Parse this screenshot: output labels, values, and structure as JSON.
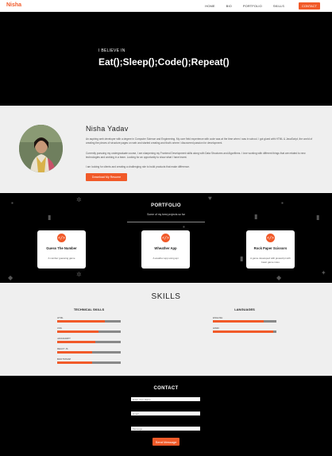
{
  "nav": {
    "brand": "Nisha",
    "links": [
      "HOME",
      "BIO",
      "PORTFOLIO",
      "SKILLS"
    ],
    "contact_label": "CONTACT"
  },
  "hero": {
    "pre": "I BELIEVE IN",
    "title": "Eat();Sleep();Code();Repeat()"
  },
  "about": {
    "name": "Nisha Yadav",
    "p1": "An aspiring web developer with a degree in Computer Science and Engineering. My core field experience with code was at the time when I was in school. I got glued with HTML & JavaScript, the world of creating the pieces of structure pages on web and started creating and that's where I discovered passion for development.",
    "p2": "Currently pursuing my undergraduate course, I am sharpening my Frontend Development skills along with Data Structures and Algorithms. I love working with different things that are related to new technologies and working in a team. Looking for an opportunity to show what I have learnt.",
    "p3": "I am looking for clients and creating a challenging role to build products that make difference.",
    "resume_label": "Download My Resume"
  },
  "portfolio": {
    "title": "PORTFOLIO",
    "subtitle": "Some of my best projects so far",
    "cards": [
      {
        "title": "Guess The Number",
        "desc": "A number guessing game",
        "icon": "code-icon"
      },
      {
        "title": "Wheather App",
        "desc": "A weather app using api",
        "icon": "code-icon"
      },
      {
        "title": "Rock Paper Scissors",
        "desc": "A game developed with javascript with basic game rules",
        "icon": "code-icon"
      }
    ]
  },
  "skills": {
    "title": "SKILLS",
    "technical_title": "TECHNICAL SKILLS",
    "languages_title": "LANGUAGES",
    "technical": [
      {
        "name": "HTML",
        "level": 0.75
      },
      {
        "name": "CSS",
        "level": 0.65
      },
      {
        "name": "JAVASCRIPT",
        "level": 0.6
      },
      {
        "name": "REACT JS",
        "level": 0.55
      },
      {
        "name": "BOOTSTRAP",
        "level": 0.55
      }
    ],
    "languages": [
      {
        "name": "ENGLISH",
        "level": 0.8
      },
      {
        "name": "HINDI",
        "level": 0.95
      }
    ]
  },
  "contact": {
    "title": "CONTACT",
    "name_placeholder": "Enter Your Name",
    "email_placeholder": "Email",
    "message_placeholder": "Message",
    "send_label": "Send Message"
  },
  "colors": {
    "accent": "#f15a29",
    "dark": "#000000",
    "light": "#efefef"
  }
}
